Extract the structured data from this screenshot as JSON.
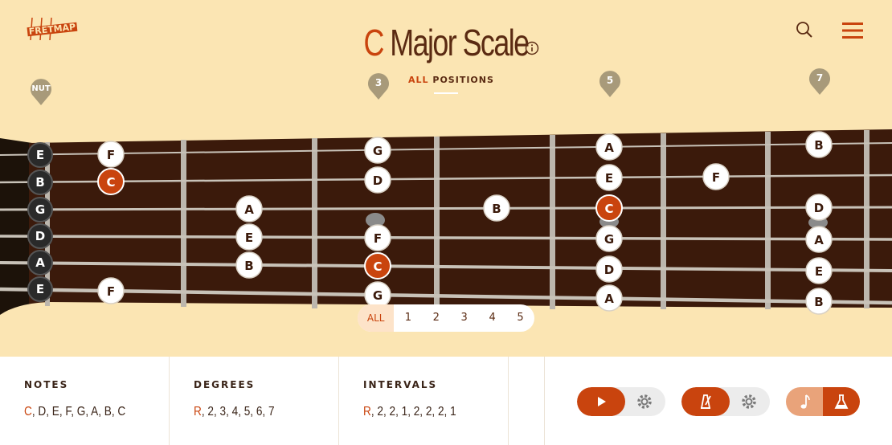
{
  "app": {
    "logo_text": "FRETMAP"
  },
  "header": {
    "title_root": "C",
    "title_rest": "Major Scale",
    "all_positions": {
      "accent": "ALL",
      "rest": "POSITIONS"
    }
  },
  "fret_markers": [
    "NUT",
    "3",
    "5",
    "7"
  ],
  "open_strings": [
    "E",
    "B",
    "G",
    "D",
    "A",
    "E"
  ],
  "notes": [
    {
      "label": "F"
    },
    {
      "label": "C"
    },
    {
      "label": "F"
    },
    {
      "label": "A"
    },
    {
      "label": "E"
    },
    {
      "label": "B"
    },
    {
      "label": "G"
    },
    {
      "label": "D"
    },
    {
      "label": "F"
    },
    {
      "label": "C"
    },
    {
      "label": "G"
    },
    {
      "label": "B"
    },
    {
      "label": "A"
    },
    {
      "label": "E"
    },
    {
      "label": "C"
    },
    {
      "label": "G"
    },
    {
      "label": "D"
    },
    {
      "label": "A"
    },
    {
      "label": "F"
    },
    {
      "label": "B"
    },
    {
      "label": "D"
    },
    {
      "label": "A"
    },
    {
      "label": "E"
    },
    {
      "label": "B"
    }
  ],
  "position_selector": [
    "ALL",
    "1",
    "2",
    "3",
    "4",
    "5"
  ],
  "panel": {
    "notes": {
      "header": "NOTES",
      "first": "C",
      "rest": ", D, E, F, G, A, B, C"
    },
    "degrees": {
      "header": "DEGREES",
      "first": "R",
      "rest": ", 2, 3, 4, 5, 6, 7"
    },
    "intervals": {
      "header": "INTERVALS",
      "first": "R",
      "rest": ", 2, 2, 1, 2, 2, 2, 1"
    }
  },
  "colors": {
    "background": "#fbe5b3",
    "fretboard": "#3b1a0b",
    "accent": "#c9440e",
    "text_dark": "#5a2a12",
    "marker": "#a89a7a"
  },
  "icons": [
    "logo",
    "info-icon",
    "search-icon",
    "menu-icon",
    "play-icon",
    "gear-icon",
    "metronome-icon",
    "note-icon",
    "flask-icon"
  ]
}
